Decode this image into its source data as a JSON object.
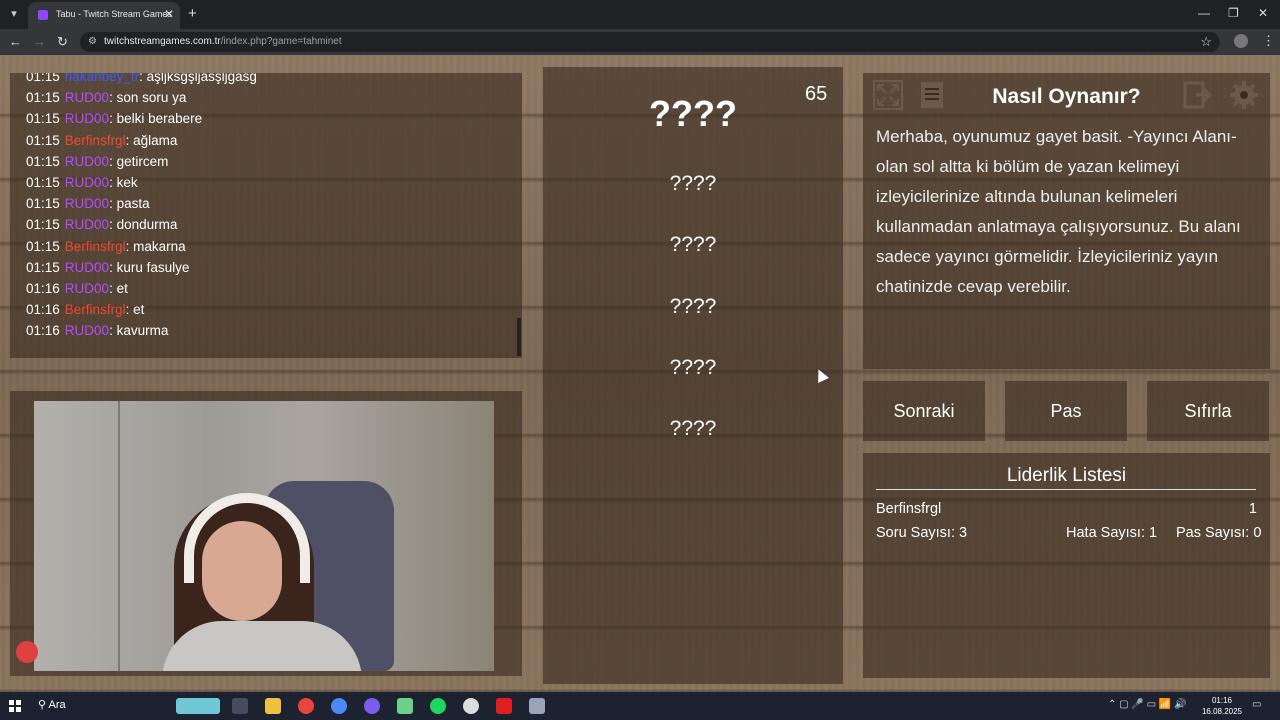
{
  "browser": {
    "tab_title": "Tabu - Twitch Stream Games",
    "tab_close": "✕",
    "new_tab": "+",
    "url_host": "twitchstreamgames.com.tr",
    "url_path": "/index.php?game=tahminet",
    "minimize": "—",
    "restore": "❐",
    "close": "✕"
  },
  "chat": {
    "messages": [
      {
        "time": "01:15",
        "user": "hakanbey_tr",
        "text": ": aşljksgşljasşljgasg",
        "color": "blue"
      },
      {
        "time": "01:15",
        "user": "RUD00",
        "text": ": son soru ya",
        "color": "purple"
      },
      {
        "time": "01:15",
        "user": "RUD00",
        "text": ": belki berabere",
        "color": "purple"
      },
      {
        "time": "01:15",
        "user": "Berfinsfrgl",
        "text": ": ağlama",
        "color": "red"
      },
      {
        "time": "01:15",
        "user": "RUD00",
        "text": ": getircem",
        "color": "purple"
      },
      {
        "time": "01:15",
        "user": "RUD00",
        "text": ": kek",
        "color": "purple"
      },
      {
        "time": "01:15",
        "user": "RUD00",
        "text": ": pasta",
        "color": "purple"
      },
      {
        "time": "01:15",
        "user": "RUD00",
        "text": ": dondurma",
        "color": "purple"
      },
      {
        "time": "01:15",
        "user": "Berfinsfrgl",
        "text": ": makarna",
        "color": "red"
      },
      {
        "time": "01:15",
        "user": "RUD00",
        "text": ": kuru fasulye",
        "color": "purple"
      },
      {
        "time": "01:16",
        "user": "RUD00",
        "text": ": et",
        "color": "purple"
      },
      {
        "time": "01:16",
        "user": "Berfinsfrgl",
        "text": ": et",
        "color": "red"
      },
      {
        "time": "01:16",
        "user": "RUD00",
        "text": ": kavurma",
        "color": "purple"
      }
    ]
  },
  "game": {
    "counter": "65",
    "main_word": "????",
    "forbidden_words": [
      "????",
      "????",
      "????",
      "????",
      "????"
    ]
  },
  "info": {
    "title": "Nasıl Oynanır?",
    "text": "Merhaba, oyunumuz gayet basit. -Yayıncı Alanı- olan sol altta ki bölüm de yazan kelimeyi izleyicilerinize altında bulunan kelimeleri kullanmadan anlatmaya çalışıyorsunuz. Bu alanı sadece yayıncı görmelidir. İzleyicileriniz yayın chatinizde cevap verebilir."
  },
  "buttons": {
    "next": "Sonraki",
    "pass": "Pas",
    "reset": "Sıfırla"
  },
  "leaderboard": {
    "title": "Liderlik Listesi",
    "player": "Berfinsfrgl",
    "score": "1",
    "question_count": "Soru Sayısı: 3",
    "error_count": "Hata Sayısı: 1",
    "pass_count": "Pas Sayısı: 0"
  },
  "taskbar": {
    "search": "Ara",
    "time": "01:16",
    "date": "16.08.2025"
  },
  "colors": {
    "purple": "#b44cff",
    "red": "#f04a2e",
    "blue": "#3a5bff"
  }
}
